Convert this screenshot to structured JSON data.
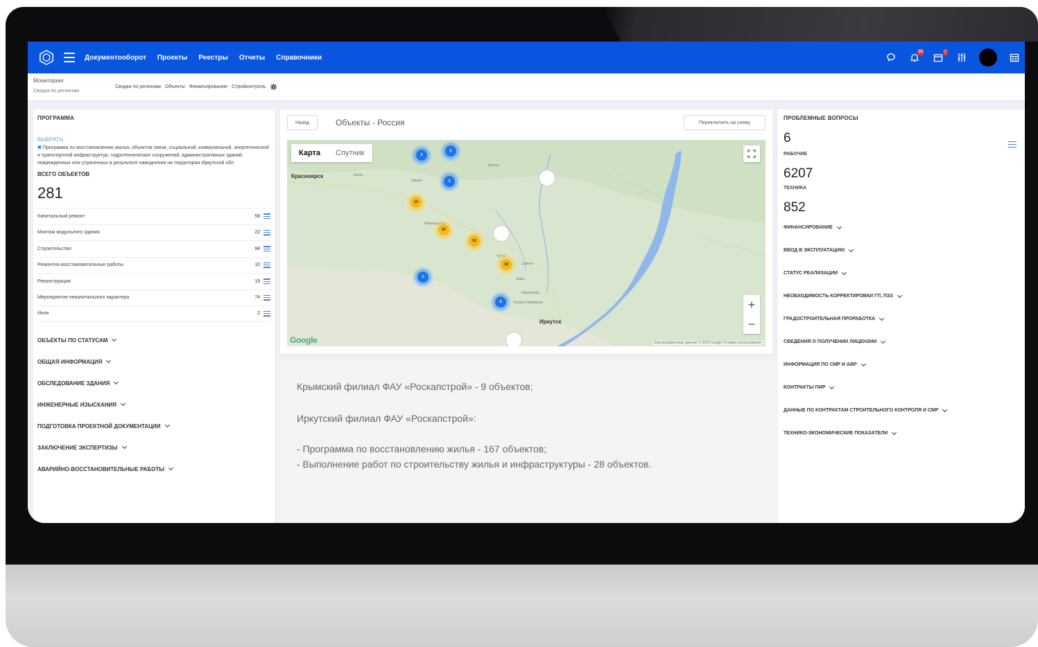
{
  "topnav": [
    "Документооборот",
    "Проекты",
    "Реестры",
    "Отчеты",
    "Справочники"
  ],
  "badges": {
    "notifications": "99",
    "calendar": "1"
  },
  "breadcrumb": {
    "section": "Мониторинг",
    "page": "Сводка по регионам"
  },
  "subtabs": [
    "Сводка по регионам",
    "Объекты",
    "Финансирование",
    "Стройконтроль"
  ],
  "left": {
    "title": "ПРОГРАММА",
    "pick": "ВЫБРАТЬ",
    "program_text": "Программа по восстановлению жилья, объектов связи, социальной, коммунальной, энергетической и транспортной инфраструктур, гидротехнических сооружений, административных зданий, поврежденных или утраченных в результате наводнения на территории Иркутской обл",
    "total_label": "ВСЕГО ОБЪЕКТОВ",
    "total": "281",
    "rows": [
      {
        "label": "Капитальный ремонт",
        "value": "58"
      },
      {
        "label": "Монтаж модульного здания",
        "value": "22"
      },
      {
        "label": "Строительство",
        "value": "94"
      },
      {
        "label": "Ремонтно-восстановительные работы",
        "value": "10"
      },
      {
        "label": "Реконструкция",
        "value": "19"
      },
      {
        "label": "Мероприятие некапитального характера",
        "value": "74"
      },
      {
        "label": "Иное",
        "value": "2"
      }
    ],
    "sections": [
      "ОБЪЕКТЫ ПО СТАТУСАМ",
      "ОБЩАЯ ИНФОРМАЦИЯ",
      "ОБСЛЕДОВАНИЕ ЗДАНИЯ",
      "ИНЖЕНЕРНЫЕ ИЗЫСКАНИЯ",
      "ПОДГОТОВКА ПРОЕКТНОЙ ДОКУМЕНТАЦИИ",
      "ЗАКЛЮЧЕНИЕ ЭКСПЕРТИЗЫ",
      "АВАРИЙНО-ВОССТАНОВИТЕЛЬНЫЕ РАБОТЫ"
    ]
  },
  "map": {
    "back": "Назад",
    "title": "Объекты - Россия",
    "switch": "Переключить на схему",
    "tab_map": "Карта",
    "tab_sat": "Спутник",
    "google": "Google",
    "attrib": "Картографические данные © 2020 Google   Условия использования",
    "cities": {
      "krasnoyarsk": "Красноярск",
      "irkutsk": "Иркутск",
      "bratsk": "Братск"
    },
    "towns": {
      "kansk": "Канск",
      "tayshet": "Тайшет",
      "nizhneudinsk": "Нижнеудинск",
      "tulun": "Тулун",
      "zima": "Зима",
      "usolye": "Усолье-Сибирское",
      "sayansk": "Саянск",
      "cheremkhovo": "Черемхово"
    },
    "clusters": {
      "c1": "3",
      "c2": "2",
      "c3": "2",
      "c4": "14",
      "c5": "57",
      "c6": "32",
      "c7": "16",
      "c8": "2",
      "c9": "5"
    }
  },
  "notes": {
    "crimea": "Крымский филиал ФАУ «Роскапстрой» - 9 объектов;",
    "irkutsk": "Иркутский филиал ФАУ «Роскапстрой»:",
    "item1": "-  Программа по восстановлению жилья - 167 объектов;",
    "item2": "-  Выполнение работ по строительству жилья  и инфраструктуры - 28 объектов."
  },
  "right": {
    "title": "ПРОБЛЕМНЫЕ ВОПРОСЫ",
    "problems": "6",
    "workers_label": "РАБОЧИЕ",
    "workers": "6207",
    "tech_label": "ТЕХНИКА",
    "tech": "852",
    "sections": [
      "ФИНАНСИРОВАНИЕ",
      "ВВОД В ЭКСПЛУАТАЦИЮ",
      "СТАТУС РЕАЛИЗАЦИИ",
      "НЕОБХОДИМОСТЬ КОРРЕКТИРОВКИ ГП, ПЗЗ",
      "ГРАДОСТРОИТЕЛЬНАЯ ПРОРАБОТКА",
      "СВЕДЕНИЯ О ПОЛУЧЕНИИ ЛИЦЕНЗИИ",
      "ИНФОРМАЦИЯ ПО СМР И АВР",
      "КОНТРАКТЫ ПИР",
      "ДАННЫЕ ПО КОНТРАКТАМ СТРОИТЕЛЬНОГО КОНТРОЛЯ И СМР",
      "ТЕХНИКО-ЭКОНОМИЧЕСКИЕ ПОКАЗАТЕЛИ"
    ]
  },
  "colors": {
    "accent": "#0a55e0",
    "cluster_blue": "#1e73e6",
    "cluster_yellow": "#f2b81a"
  }
}
